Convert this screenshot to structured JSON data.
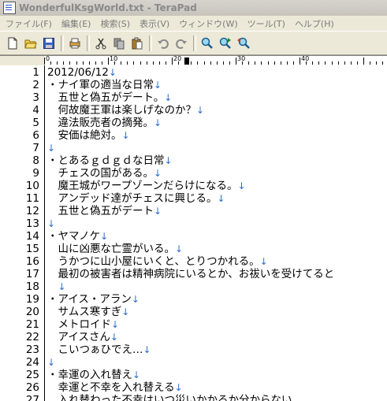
{
  "window": {
    "title": "WonderfulKsgWorld.txt - TeraPad"
  },
  "menu": [
    "ファイル(F)",
    "編集(E)",
    "検索(S)",
    "表示(V)",
    "ウィンドウ(W)",
    "ツール(T)",
    "ヘルプ(H)"
  ],
  "toolbar": [
    {
      "icon": "new-file-icon"
    },
    {
      "icon": "open-folder-icon"
    },
    {
      "icon": "save-icon"
    },
    {
      "sep": true
    },
    {
      "icon": "print-icon"
    },
    {
      "sep": true
    },
    {
      "icon": "cut-icon"
    },
    {
      "icon": "copy-icon"
    },
    {
      "icon": "paste-icon"
    },
    {
      "sep": true
    },
    {
      "icon": "undo-icon"
    },
    {
      "icon": "redo-icon"
    },
    {
      "sep": true
    },
    {
      "icon": "find-icon"
    },
    {
      "icon": "find-next-icon"
    },
    {
      "icon": "find-prev-icon"
    }
  ],
  "ruler": {
    "labels": [
      "0",
      "10",
      "20",
      "30",
      "40"
    ]
  },
  "newline_mark": "↓",
  "lines": [
    {
      "n": "1",
      "text": "2012/06/12",
      "nl": true
    },
    {
      "n": "2",
      "text": "・ナイ軍の適当な日常",
      "nl": true
    },
    {
      "n": "3",
      "text": "　五世と偽五がデート。",
      "nl": true
    },
    {
      "n": "4",
      "text": "　何故魔王軍は楽しげなのか？",
      "nl": true
    },
    {
      "n": "5",
      "text": "　違法販売者の摘発。",
      "nl": true
    },
    {
      "n": "6",
      "text": "　安価は絶対。",
      "nl": true
    },
    {
      "n": "7",
      "text": "",
      "nl": true
    },
    {
      "n": "8",
      "text": "・とあるｇｄｇｄな日常",
      "nl": true
    },
    {
      "n": "9",
      "text": "　チェスの国がある。",
      "nl": true
    },
    {
      "n": "10",
      "text": "　魔王城がワープゾーンだらけになる。",
      "nl": true
    },
    {
      "n": "11",
      "text": "　アンデッド達がチェスに興じる。",
      "nl": true
    },
    {
      "n": "12",
      "text": "　五世と偽五がデート",
      "nl": true
    },
    {
      "n": "13",
      "text": "",
      "nl": true
    },
    {
      "n": "14",
      "text": "・ヤマノケ",
      "nl": true
    },
    {
      "n": "15",
      "text": "　山に凶悪な亡霊がいる。",
      "nl": true
    },
    {
      "n": "16",
      "text": "　うかつに山小屋にいくと、とりつかれる。",
      "nl": true
    },
    {
      "n": "17",
      "text": "　最初の被害者は精神病院にいるとか、お祓いを受けてると",
      "nl": false
    },
    {
      "n": "18",
      "text": "　",
      "nl": true
    },
    {
      "n": "19",
      "text": "・アイス・アラン",
      "nl": true
    },
    {
      "n": "20",
      "text": "　サムス寒すぎ",
      "nl": true
    },
    {
      "n": "21",
      "text": "　メトロイド",
      "nl": true
    },
    {
      "n": "22",
      "text": "　アイスさん",
      "nl": true
    },
    {
      "n": "23",
      "text": "　こいつぁひでえ…",
      "nl": true
    },
    {
      "n": "24",
      "text": "",
      "nl": true
    },
    {
      "n": "25",
      "text": "・幸運の入れ替え",
      "nl": true
    },
    {
      "n": "26",
      "text": "　幸運と不幸を入れ替える",
      "nl": true
    },
    {
      "n": "27",
      "text": "　入れ替わった不幸はいつ災いかかるか分からない",
      "nl": false
    }
  ]
}
